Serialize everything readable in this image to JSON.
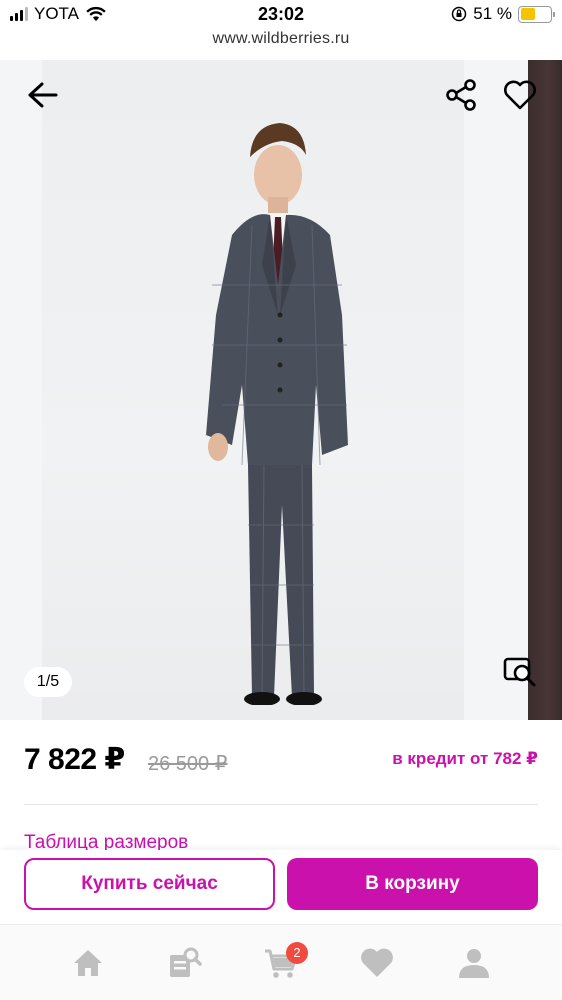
{
  "status_bar": {
    "carrier": "YOTA",
    "time": "23:02",
    "battery_percent": "51 %",
    "battery_level": 0.51
  },
  "browser": {
    "url": "www.wildberries.ru"
  },
  "gallery": {
    "counter": "1/5",
    "current_image": 1,
    "total_images": 5
  },
  "product": {
    "price": "7 822 ₽",
    "old_price": "26 500 ₽",
    "credit": "в кредит от 782 ₽",
    "size_table_link": "Таблица размеров"
  },
  "actions": {
    "buy_now": "Купить сейчас",
    "add_to_cart": "В корзину"
  },
  "tabbar": {
    "cart_badge": "2",
    "items": [
      "home-icon",
      "catalog-search-icon",
      "cart-icon",
      "favorites-icon",
      "profile-icon"
    ]
  },
  "colors": {
    "accent": "#cb11ab",
    "badge": "#f04b3e",
    "battery": "#f5c400"
  }
}
